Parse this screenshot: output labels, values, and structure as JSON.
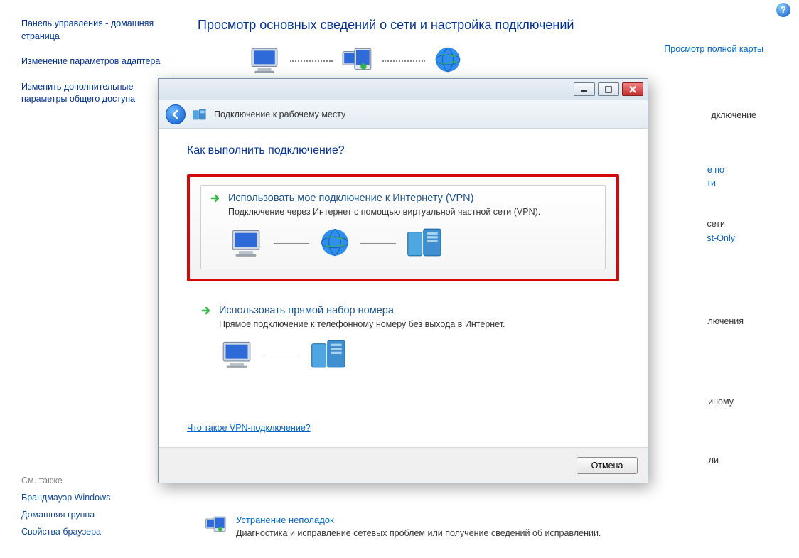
{
  "help_glyph": "?",
  "sidebar": {
    "home": "Панель управления - домашняя страница",
    "adapter": "Изменение параметров адаптера",
    "advanced": "Изменить дополнительные параметры общего доступа",
    "see_also_title": "См. также",
    "firewall": "Брандмауэр Windows",
    "homegroup": "Домашняя группа",
    "browser_props": "Свойства браузера"
  },
  "main": {
    "heading": "Просмотр основных сведений о сети и настройка подключений",
    "full_map": "Просмотр полной карты",
    "troubleshoot_title": "Устранение неполадок",
    "troubleshoot_desc": "Диагностика и исправление сетевых проблем или получение сведений об исправлении."
  },
  "partials": {
    "p1": "дключение",
    "p2": "е по",
    "p3": "ти",
    "p4": "сети",
    "p5": "st-Only",
    "p6": "лючения",
    "p7": "иному",
    "p8": "ли"
  },
  "dialog": {
    "header_title": "Подключение к рабочему месту",
    "question": "Как выполнить подключение?",
    "opt1_title": "Использовать мое подключение к Интернету (VPN)",
    "opt1_desc": "Подключение через Интернет с помощью виртуальной частной сети (VPN).",
    "opt2_title": "Использовать прямой набор номера",
    "opt2_desc": "Прямое подключение к телефонному номеру без выхода в Интернет.",
    "vpn_link": "Что такое VPN-подключение?",
    "cancel": "Отмена"
  }
}
